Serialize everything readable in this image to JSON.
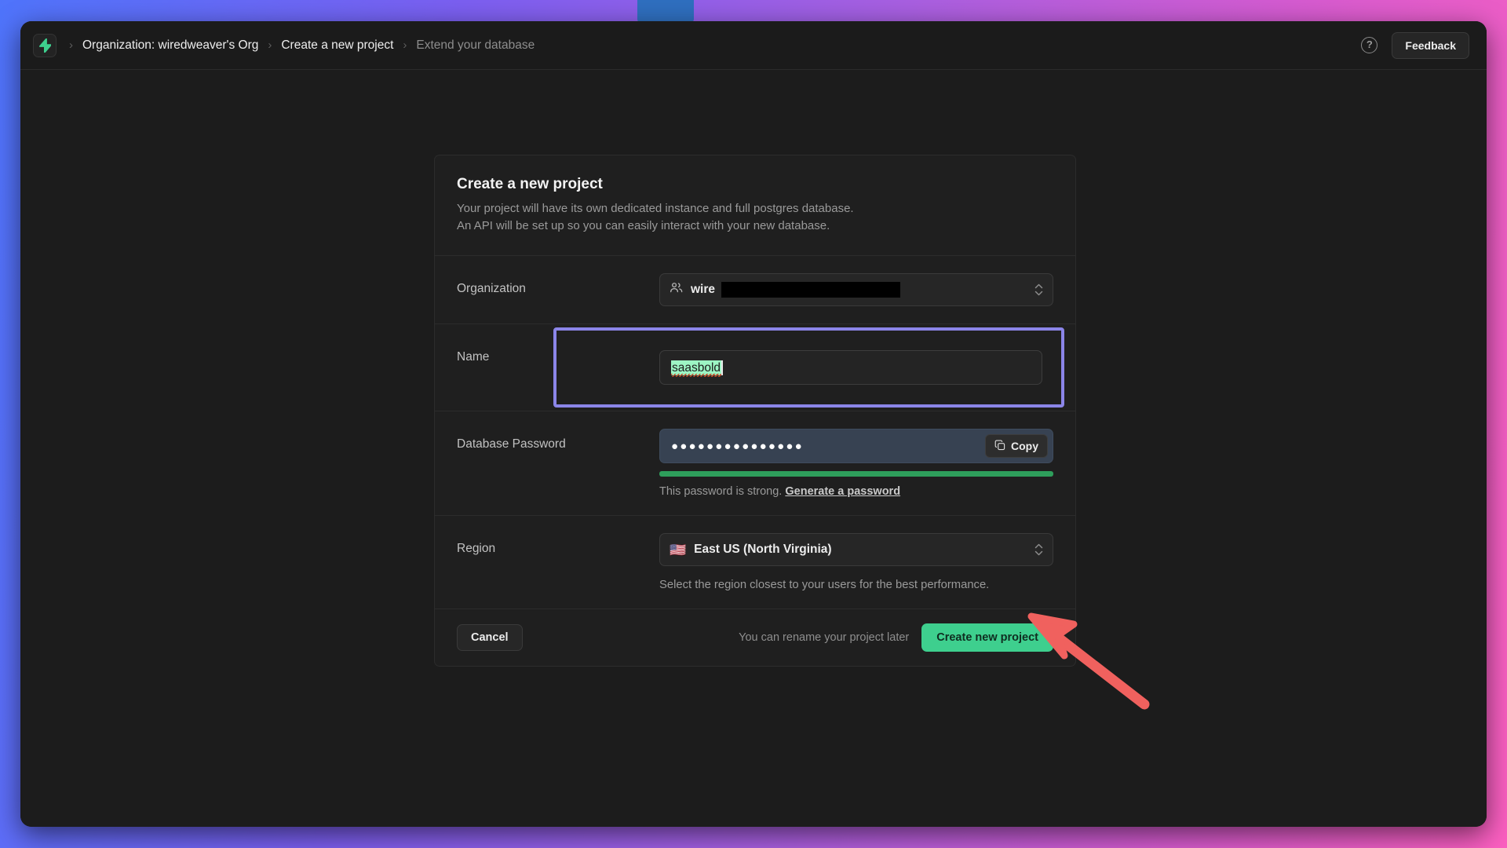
{
  "header": {
    "logo_icon": "lightning-bolt-logo",
    "breadcrumb": [
      {
        "label": "Organization: wiredweaver's Org",
        "dim": false
      },
      {
        "label": "Create a new project",
        "dim": false
      },
      {
        "label": "Extend your database",
        "dim": true
      }
    ],
    "separator": "›",
    "help_icon": "help-circle-icon",
    "help_glyph": "?",
    "feedback_label": "Feedback"
  },
  "card": {
    "title": "Create a new project",
    "subtitle_line1": "Your project will have its own dedicated instance and full postgres database.",
    "subtitle_line2": "An API will be set up so you can easily interact with your new database.",
    "organization": {
      "label": "Organization",
      "icon": "users-icon",
      "value_visible": "wire",
      "value_redacted": true
    },
    "name": {
      "label": "Name",
      "value": "saasbold",
      "selected": true,
      "spellcheck_underline": true,
      "focused": true,
      "focus_ring_color": "#8b85e8"
    },
    "password": {
      "label": "Database Password",
      "masked_value": "●●●●●●●●●●●●●●●",
      "copy_label": "Copy",
      "copy_icon": "copy-icon",
      "strength_percent": 100,
      "strength_color": "#2e9e5b",
      "hint_text": "This password is strong.",
      "hint_link": "Generate a password"
    },
    "region": {
      "label": "Region",
      "flag": "🇺🇸",
      "value": "East US (North Virginia)",
      "hint": "Select the region closest to your users for the best performance."
    },
    "footer": {
      "cancel_label": "Cancel",
      "note": "You can rename your project later",
      "create_label": "Create new project",
      "create_color": "#3ecf8e"
    }
  },
  "annotation": {
    "arrow_color": "#f0615e",
    "arrow_points_to": "create-new-project-button"
  }
}
